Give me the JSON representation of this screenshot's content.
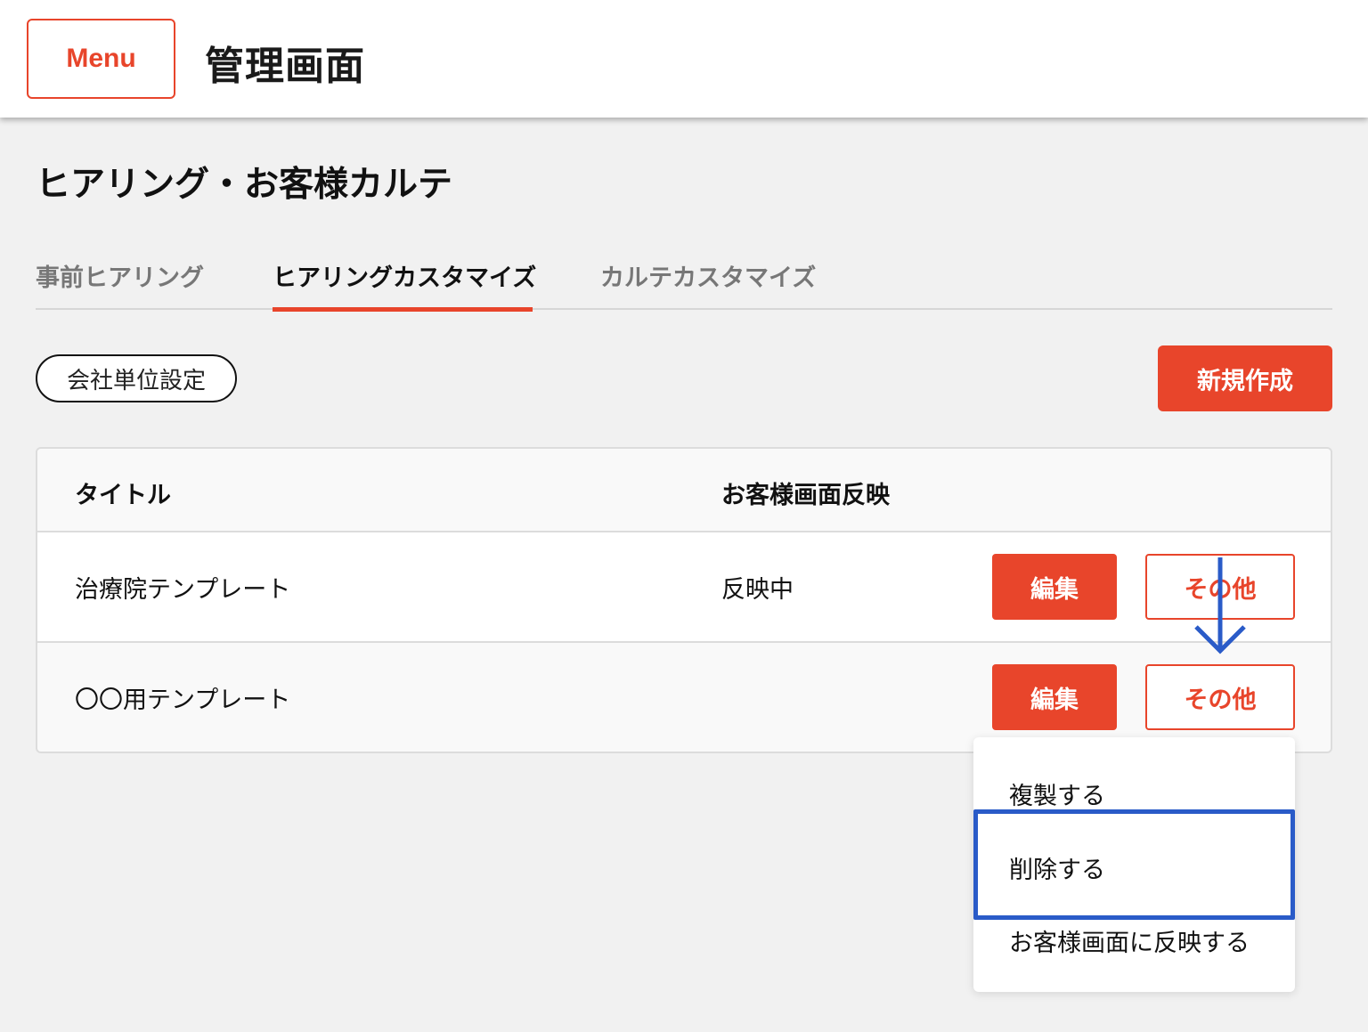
{
  "header": {
    "menu_label": "Menu",
    "app_title": "管理画面"
  },
  "page": {
    "title": "ヒアリング・お客様カルテ"
  },
  "tabs": [
    {
      "label": "事前ヒアリング",
      "active": false
    },
    {
      "label": "ヒアリングカスタマイズ",
      "active": true
    },
    {
      "label": "カルテカスタマイズ",
      "active": false
    }
  ],
  "toolbar": {
    "company_settings_label": "会社単位設定",
    "new_label": "新規作成"
  },
  "table": {
    "headers": {
      "title": "タイトル",
      "reflect": "お客様画面反映"
    },
    "rows": [
      {
        "title": "治療院テンプレート",
        "reflect": "反映中",
        "edit_label": "編集",
        "other_label": "その他"
      },
      {
        "title": "〇〇用テンプレート",
        "reflect": "",
        "edit_label": "編集",
        "other_label": "その他"
      }
    ]
  },
  "dropdown": {
    "items": [
      {
        "label": "複製する"
      },
      {
        "label": "削除する",
        "highlighted": true
      },
      {
        "label": "お客様画面に反映する"
      }
    ]
  },
  "colors": {
    "accent": "#e8452b",
    "annotation": "#2a5bc8",
    "background": "#f1f1f1"
  }
}
